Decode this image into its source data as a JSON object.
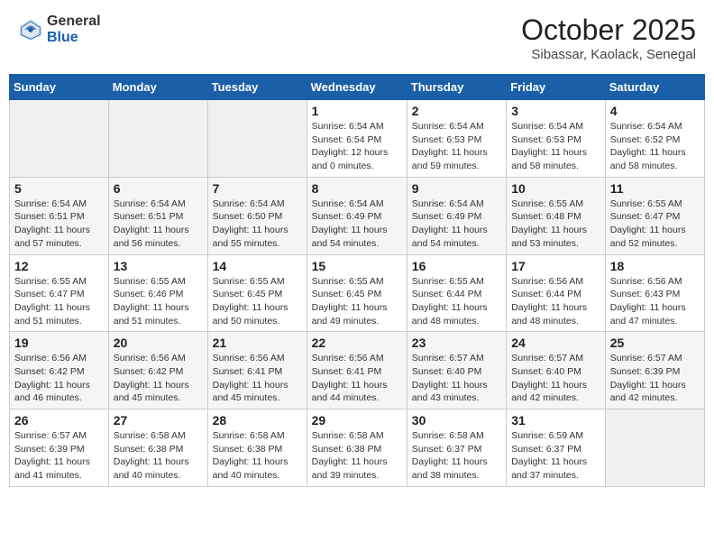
{
  "header": {
    "logo_general": "General",
    "logo_blue": "Blue",
    "month_title": "October 2025",
    "location": "Sibassar, Kaolack, Senegal"
  },
  "weekdays": [
    "Sunday",
    "Monday",
    "Tuesday",
    "Wednesday",
    "Thursday",
    "Friday",
    "Saturday"
  ],
  "weeks": [
    [
      {
        "day": "",
        "info": ""
      },
      {
        "day": "",
        "info": ""
      },
      {
        "day": "",
        "info": ""
      },
      {
        "day": "1",
        "info": "Sunrise: 6:54 AM\nSunset: 6:54 PM\nDaylight: 12 hours\nand 0 minutes."
      },
      {
        "day": "2",
        "info": "Sunrise: 6:54 AM\nSunset: 6:53 PM\nDaylight: 11 hours\nand 59 minutes."
      },
      {
        "day": "3",
        "info": "Sunrise: 6:54 AM\nSunset: 6:53 PM\nDaylight: 11 hours\nand 58 minutes."
      },
      {
        "day": "4",
        "info": "Sunrise: 6:54 AM\nSunset: 6:52 PM\nDaylight: 11 hours\nand 58 minutes."
      }
    ],
    [
      {
        "day": "5",
        "info": "Sunrise: 6:54 AM\nSunset: 6:51 PM\nDaylight: 11 hours\nand 57 minutes."
      },
      {
        "day": "6",
        "info": "Sunrise: 6:54 AM\nSunset: 6:51 PM\nDaylight: 11 hours\nand 56 minutes."
      },
      {
        "day": "7",
        "info": "Sunrise: 6:54 AM\nSunset: 6:50 PM\nDaylight: 11 hours\nand 55 minutes."
      },
      {
        "day": "8",
        "info": "Sunrise: 6:54 AM\nSunset: 6:49 PM\nDaylight: 11 hours\nand 54 minutes."
      },
      {
        "day": "9",
        "info": "Sunrise: 6:54 AM\nSunset: 6:49 PM\nDaylight: 11 hours\nand 54 minutes."
      },
      {
        "day": "10",
        "info": "Sunrise: 6:55 AM\nSunset: 6:48 PM\nDaylight: 11 hours\nand 53 minutes."
      },
      {
        "day": "11",
        "info": "Sunrise: 6:55 AM\nSunset: 6:47 PM\nDaylight: 11 hours\nand 52 minutes."
      }
    ],
    [
      {
        "day": "12",
        "info": "Sunrise: 6:55 AM\nSunset: 6:47 PM\nDaylight: 11 hours\nand 51 minutes."
      },
      {
        "day": "13",
        "info": "Sunrise: 6:55 AM\nSunset: 6:46 PM\nDaylight: 11 hours\nand 51 minutes."
      },
      {
        "day": "14",
        "info": "Sunrise: 6:55 AM\nSunset: 6:45 PM\nDaylight: 11 hours\nand 50 minutes."
      },
      {
        "day": "15",
        "info": "Sunrise: 6:55 AM\nSunset: 6:45 PM\nDaylight: 11 hours\nand 49 minutes."
      },
      {
        "day": "16",
        "info": "Sunrise: 6:55 AM\nSunset: 6:44 PM\nDaylight: 11 hours\nand 48 minutes."
      },
      {
        "day": "17",
        "info": "Sunrise: 6:56 AM\nSunset: 6:44 PM\nDaylight: 11 hours\nand 48 minutes."
      },
      {
        "day": "18",
        "info": "Sunrise: 6:56 AM\nSunset: 6:43 PM\nDaylight: 11 hours\nand 47 minutes."
      }
    ],
    [
      {
        "day": "19",
        "info": "Sunrise: 6:56 AM\nSunset: 6:42 PM\nDaylight: 11 hours\nand 46 minutes."
      },
      {
        "day": "20",
        "info": "Sunrise: 6:56 AM\nSunset: 6:42 PM\nDaylight: 11 hours\nand 45 minutes."
      },
      {
        "day": "21",
        "info": "Sunrise: 6:56 AM\nSunset: 6:41 PM\nDaylight: 11 hours\nand 45 minutes."
      },
      {
        "day": "22",
        "info": "Sunrise: 6:56 AM\nSunset: 6:41 PM\nDaylight: 11 hours\nand 44 minutes."
      },
      {
        "day": "23",
        "info": "Sunrise: 6:57 AM\nSunset: 6:40 PM\nDaylight: 11 hours\nand 43 minutes."
      },
      {
        "day": "24",
        "info": "Sunrise: 6:57 AM\nSunset: 6:40 PM\nDaylight: 11 hours\nand 42 minutes."
      },
      {
        "day": "25",
        "info": "Sunrise: 6:57 AM\nSunset: 6:39 PM\nDaylight: 11 hours\nand 42 minutes."
      }
    ],
    [
      {
        "day": "26",
        "info": "Sunrise: 6:57 AM\nSunset: 6:39 PM\nDaylight: 11 hours\nand 41 minutes."
      },
      {
        "day": "27",
        "info": "Sunrise: 6:58 AM\nSunset: 6:38 PM\nDaylight: 11 hours\nand 40 minutes."
      },
      {
        "day": "28",
        "info": "Sunrise: 6:58 AM\nSunset: 6:38 PM\nDaylight: 11 hours\nand 40 minutes."
      },
      {
        "day": "29",
        "info": "Sunrise: 6:58 AM\nSunset: 6:38 PM\nDaylight: 11 hours\nand 39 minutes."
      },
      {
        "day": "30",
        "info": "Sunrise: 6:58 AM\nSunset: 6:37 PM\nDaylight: 11 hours\nand 38 minutes."
      },
      {
        "day": "31",
        "info": "Sunrise: 6:59 AM\nSunset: 6:37 PM\nDaylight: 11 hours\nand 37 minutes."
      },
      {
        "day": "",
        "info": ""
      }
    ]
  ]
}
